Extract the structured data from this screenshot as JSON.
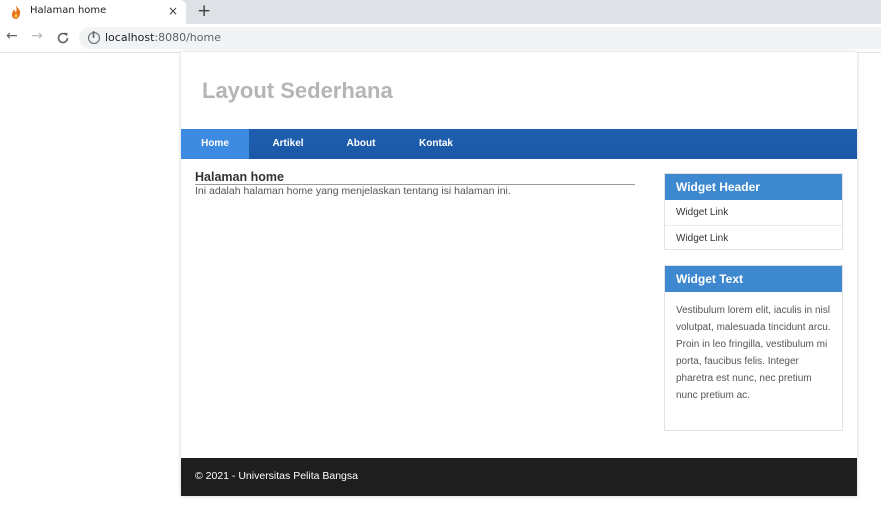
{
  "browser": {
    "tab_title": "Halaman home",
    "tab_close": "×",
    "new_tab": "+",
    "url_host": "localhost",
    "url_path": ":8080/home",
    "back": "←",
    "forward": "→",
    "reload": "C"
  },
  "site": {
    "title": "Layout Sederhana"
  },
  "nav": {
    "items": [
      {
        "label": "Home",
        "active": true
      },
      {
        "label": "Artikel"
      },
      {
        "label": "About"
      },
      {
        "label": "Kontak"
      }
    ]
  },
  "main": {
    "heading": "Halaman home",
    "text": "Ini adalah halaman home yang menjelaskan tentang isi halaman ini."
  },
  "sidebar": {
    "widget1": {
      "header": "Widget Header",
      "links": [
        "Widget Link",
        "Widget Link"
      ]
    },
    "widget2": {
      "header": "Widget Text",
      "text": "Vestibulum lorem elit, iaculis in nisl volutpat, malesuada tincidunt arcu. Proin in leo fringilla, vestibulum mi porta, faucibus felis. Integer pharetra est nunc, nec pretium nunc pretium ac."
    }
  },
  "footer": {
    "text": "© 2021 - Universitas Pelita Bangsa"
  },
  "colors": {
    "nav_bg": "#1b57a6",
    "nav_active": "#3d8be0",
    "widget_header": "#3d88cf",
    "footer_bg": "#1e1e1e"
  },
  "icons": {
    "favicon": "flame-icon",
    "site_info": "info-icon"
  }
}
